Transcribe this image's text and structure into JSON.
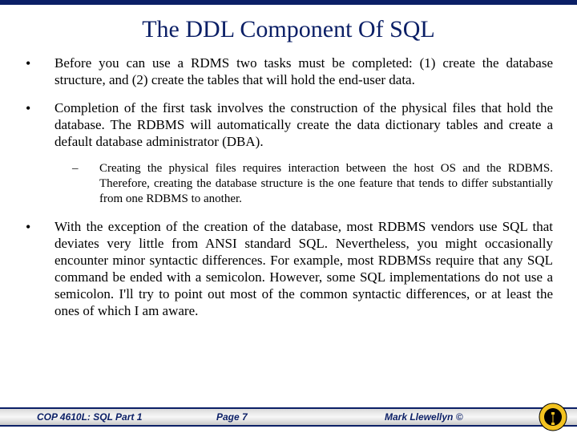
{
  "title": "The DDL Component Of SQL",
  "bullets": [
    {
      "text": "Before you can use a RDMS two tasks must be completed: (1) create the database structure, and (2) create the tables that will hold the end-user data."
    },
    {
      "text": "Completion of the first task involves the construction of the physical files that hold the database.  The RDBMS will automatically create the data dictionary tables and create a default database administrator (DBA).",
      "sub": "Creating the physical files requires interaction between the host OS and the RDBMS.  Therefore, creating the database structure is the one feature that tends to differ substantially from one RDBMS to another."
    },
    {
      "text": "With the exception of the creation of the database, most RDBMS vendors use SQL that deviates very little from ANSI standard SQL.  Nevertheless, you might occasionally encounter minor syntactic differences.  For example, most RDBMSs require that any SQL command be ended with a semicolon.  However, some SQL implementations do not use a semicolon.  I'll try to point out most of the common syntactic differences, or at least the ones of which I am aware."
    }
  ],
  "footer": {
    "course": "COP 4610L: SQL Part 1",
    "page": "Page 7",
    "author": "Mark Llewellyn ©"
  }
}
